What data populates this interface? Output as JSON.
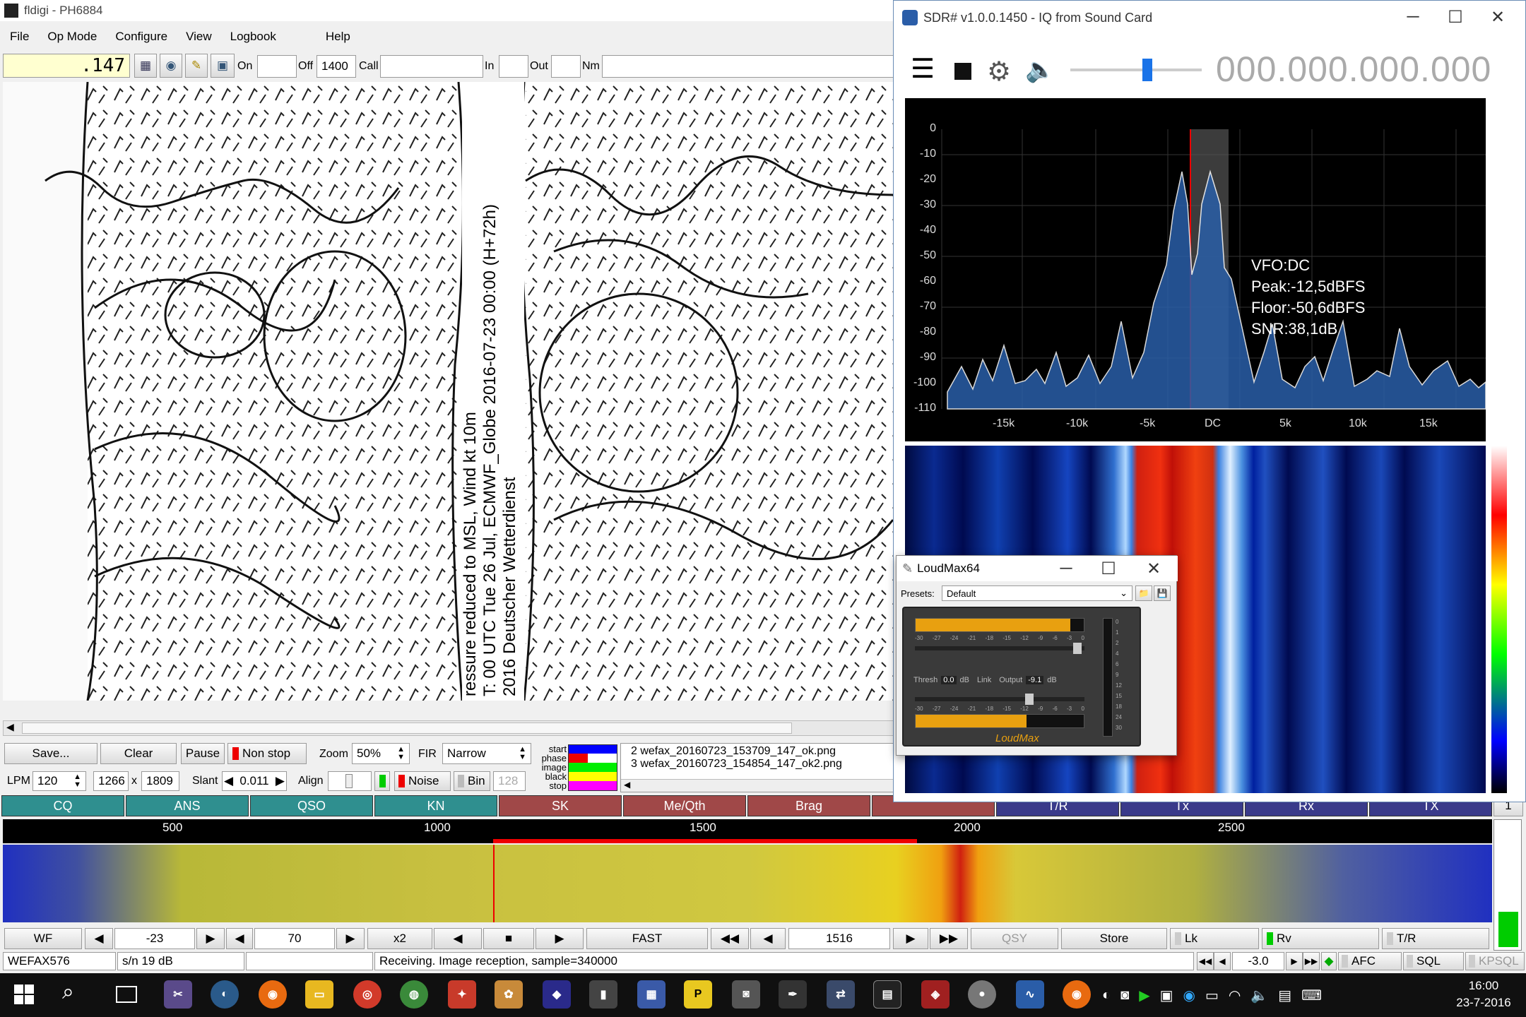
{
  "fldigi": {
    "title": "fldigi - PH6884",
    "menu": [
      "File",
      "Op Mode",
      "Configure",
      "View",
      "Logbook",
      "Help"
    ],
    "freq": ".147",
    "on_label": "On",
    "off_label": "Off",
    "off_value": "1400",
    "call_label": "Call",
    "in_label": "In",
    "out_label": "Out",
    "nm_label": "Nm",
    "map_texts": [
      "ressure reduced to MSL, Wind kt 10m",
      "T: 00 UTC Tue 26 Jul, ECMWF_Globe 2016-07-23 00:00  (H+72h)",
      "2016 Deutscher Wetterdienst"
    ],
    "save": "Save...",
    "clear": "Clear",
    "pause": "Pause",
    "nonstop": "Non stop",
    "zoom_label": "Zoom",
    "zoom_value": "50%",
    "fir_label": "FIR",
    "fir_value": "Narrow",
    "lpm_label": "LPM",
    "lpm_value": "120",
    "width": "1266",
    "x": "x",
    "height": "1809",
    "slant_label": "Slant",
    "slant_value": "0.011",
    "align_label": "Align",
    "noise": "Noise",
    "bin": "Bin",
    "bin_value": "128",
    "phase_labels": [
      "start",
      "phase",
      "image",
      "black",
      "stop"
    ],
    "files": [
      "2 wefax_20160723_153709_147_ok.png",
      "3 wefax_20160723_154854_147_ok2.png"
    ],
    "macros": [
      "CQ",
      "ANS",
      "QSO",
      "KN",
      "SK",
      "Me/Qth",
      "Brag",
      "",
      "T/R",
      "Tx",
      "Rx",
      "TX"
    ],
    "macro_num": "1",
    "scale": [
      "500",
      "1000",
      "1500",
      "2000",
      "2500"
    ],
    "wf": "WF",
    "wf_level": "-23",
    "wf_range": "70",
    "x2": "x2",
    "fast": "FAST",
    "carrier": "1516",
    "qsy": "QSY",
    "store": "Store",
    "lk": "Lk",
    "rv": "Rv",
    "tr": "T/R",
    "mode": "WEFAX576",
    "sn": "s/n  19 dB",
    "status": "Receiving. Image reception, sample=340000",
    "afc_value": "-3.0",
    "afc": "AFC",
    "sql": "SQL",
    "kpsql": "KPSQL"
  },
  "sdr": {
    "title": "SDR# v1.0.0.1450 - IQ from Sound Card",
    "freq": "000.000.000.000",
    "db_ticks": [
      "0",
      "-10",
      "-20",
      "-30",
      "-40",
      "-50",
      "-60",
      "-70",
      "-80",
      "-90",
      "-100",
      "-110"
    ],
    "x_ticks": [
      "-15k",
      "-10k",
      "-5k",
      "DC",
      "5k",
      "10k",
      "15k"
    ],
    "info": [
      "VFO:DC",
      "Peak:-12,5dBFS",
      "Floor:-50,6dBFS",
      "SNR:38,1dB"
    ]
  },
  "loudmax": {
    "title": "LoudMax64",
    "presets_label": "Presets:",
    "preset": "Default",
    "scale": [
      "-30",
      "-27",
      "-24",
      "-21",
      "-18",
      "-15",
      "-12",
      "-9",
      "-6",
      "-3",
      "0"
    ],
    "thresh_label": "Thresh",
    "thresh": "0.0",
    "db": "dB",
    "link": "Link",
    "output_label": "Output",
    "output": "-9.1",
    "right_scale": [
      "0",
      "1",
      "2",
      "4",
      "6",
      "9",
      "12",
      "15",
      "18",
      "24",
      "30"
    ],
    "logo": "LoudMax"
  },
  "taskbar": {
    "time": "16:00",
    "date": "23-7-2016"
  }
}
